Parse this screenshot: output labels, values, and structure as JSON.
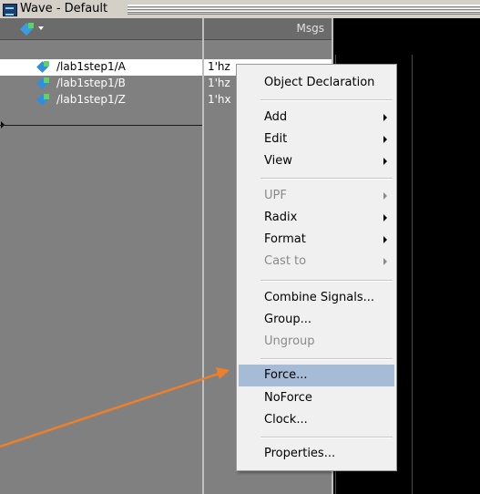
{
  "window": {
    "title": "Wave - Default"
  },
  "columns": {
    "values_title": "Msgs"
  },
  "signals": [
    {
      "name": "/lab1step1/A",
      "value": "1'hz"
    },
    {
      "name": "/lab1step1/B",
      "value": "1'hz"
    },
    {
      "name": "/lab1step1/Z",
      "value": "1'hx"
    }
  ],
  "context_menu": {
    "object_declaration": "Object Declaration",
    "add": "Add",
    "edit": "Edit",
    "view": "View",
    "upf": "UPF",
    "radix": "Radix",
    "format": "Format",
    "cast_to": "Cast to",
    "combine_signals": "Combine Signals...",
    "group": "Group...",
    "ungroup": "Ungroup",
    "force": "Force...",
    "noforce": "NoForce",
    "clock": "Clock...",
    "properties": "Properties..."
  },
  "colors": {
    "highlight": "#a6bcd6",
    "annotation_arrow": "#f07f2a"
  }
}
